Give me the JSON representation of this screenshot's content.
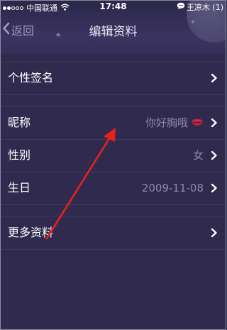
{
  "statusbar": {
    "carrier": "中国联通",
    "time": "17:48",
    "user": "王凉木 (1)"
  },
  "navbar": {
    "back_label": "返回",
    "title": "编辑资料"
  },
  "rows": {
    "signature": {
      "label": "个性签名"
    },
    "nickname": {
      "label": "昵称",
      "value": "你好胸哦"
    },
    "gender": {
      "label": "性别",
      "value": "女"
    },
    "birthday": {
      "label": "生日",
      "value": "2009-11-08"
    },
    "more": {
      "label": "更多资料"
    }
  },
  "icons": {
    "back": "chevron-left-icon",
    "row_arrow": "chevron-right-icon",
    "nickname_decoration": "lips-icon",
    "wifi": "wifi-icon",
    "chat": "chat-bubble-icon"
  },
  "colors": {
    "background": "#2f2a4e",
    "label_text": "#ffffff",
    "value_text": "#8d89a8",
    "annotation_arrow": "#e8201f",
    "lips": "#e0234a"
  }
}
